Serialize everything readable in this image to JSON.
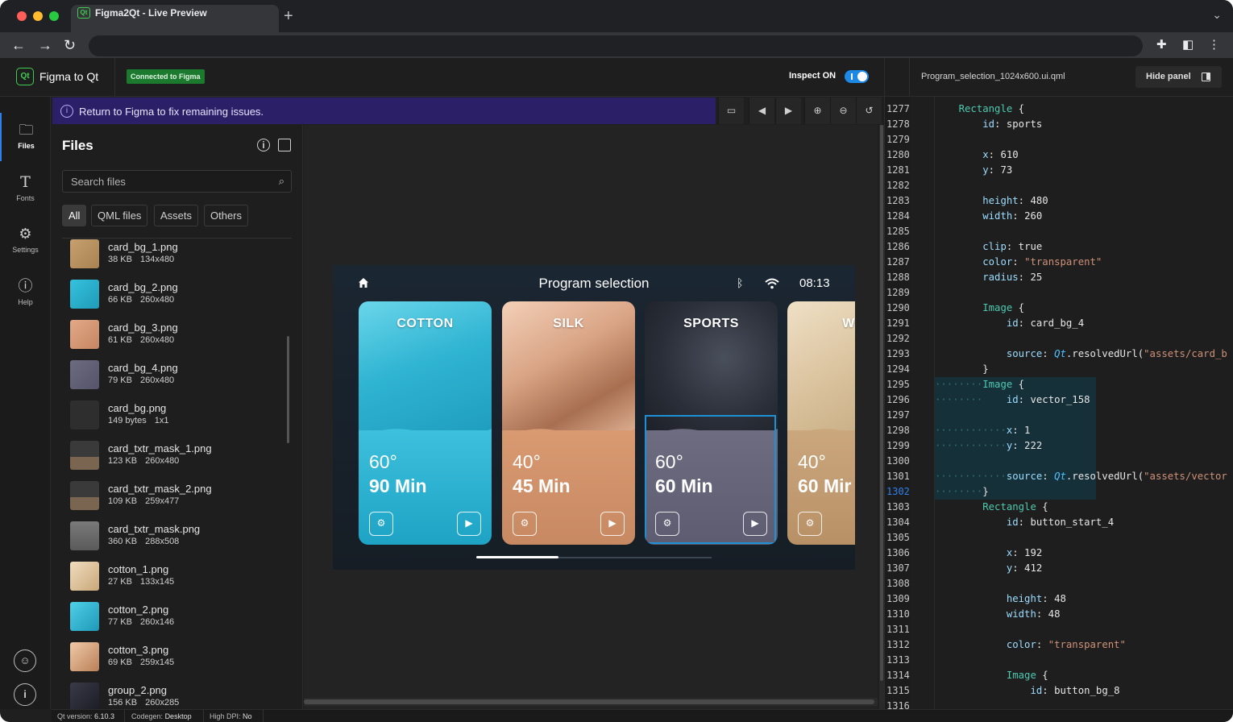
{
  "browser": {
    "tab_title": "Figma2Qt - Live Preview",
    "tab_favicon_text": "Qt",
    "traffic_colors": [
      "#ff5f57",
      "#febc2e",
      "#28c840"
    ]
  },
  "app": {
    "logo_text": "Qt",
    "title": "Figma to Qt",
    "connection_badge": "Connected to Figma",
    "inspect_label": "Inspect ON",
    "inspect_on": true,
    "accent_color": "#1e88e5"
  },
  "rail": {
    "items": [
      {
        "label": "Files",
        "icon": "folder-icon",
        "active": true
      },
      {
        "label": "Fonts",
        "icon": "text-icon",
        "active": false
      },
      {
        "label": "Settings",
        "icon": "gear-icon",
        "active": false
      },
      {
        "label": "Help",
        "icon": "help-icon",
        "active": false
      }
    ],
    "bottom_icons": [
      "user-icon",
      "info-icon"
    ]
  },
  "banner": {
    "text": "Return to Figma to fix remaining issues."
  },
  "preview_toolbar": [
    "monitor-icon",
    "prev-icon",
    "next-icon",
    "zoom-in-icon",
    "zoom-out-icon",
    "reset-icon"
  ],
  "files": {
    "title": "Files",
    "search_placeholder": "Search files",
    "filters": [
      {
        "label": "All",
        "active": true
      },
      {
        "label": "QML files",
        "active": false
      },
      {
        "label": "Assets",
        "active": false
      },
      {
        "label": "Others",
        "active": false
      }
    ],
    "items": [
      {
        "name": "card_bg_1.png",
        "size": "38 KB",
        "dims": "134x480",
        "thumb": "linear-gradient(135deg,#c8a070,#a88250)"
      },
      {
        "name": "card_bg_2.png",
        "size": "66 KB",
        "dims": "260x480",
        "thumb": "linear-gradient(135deg,#35c2dd,#1f9bb8)"
      },
      {
        "name": "card_bg_3.png",
        "size": "61 KB",
        "dims": "260x480",
        "thumb": "linear-gradient(135deg,#e3a988,#c58662)"
      },
      {
        "name": "card_bg_4.png",
        "size": "79 KB",
        "dims": "260x480",
        "thumb": "linear-gradient(135deg,#6c6b7f,#55546a)"
      },
      {
        "name": "card_bg.png",
        "size": "149 bytes",
        "dims": "1x1",
        "thumb": "#2e2e2e"
      },
      {
        "name": "card_txtr_mask_1.png",
        "size": "123 KB",
        "dims": "260x480",
        "thumb": "linear-gradient(180deg,#3a3a3a 55%,#7a6550 56%)"
      },
      {
        "name": "card_txtr_mask_2.png",
        "size": "109 KB",
        "dims": "259x477",
        "thumb": "linear-gradient(180deg,#3a3a3a 55%,#7a6550 56%)"
      },
      {
        "name": "card_txtr_mask.png",
        "size": "360 KB",
        "dims": "288x508",
        "thumb": "linear-gradient(180deg,#7a7a7a,#5a5a5a)"
      },
      {
        "name": "cotton_1.png",
        "size": "27 KB",
        "dims": "133x145",
        "thumb": "linear-gradient(135deg,#f0dcc0,#c9a878)"
      },
      {
        "name": "cotton_2.png",
        "size": "77 KB",
        "dims": "260x146",
        "thumb": "linear-gradient(135deg,#4fd0e8,#1f98b8)"
      },
      {
        "name": "cotton_3.png",
        "size": "69 KB",
        "dims": "259x145",
        "thumb": "linear-gradient(135deg,#f1c9a8,#b88058)"
      },
      {
        "name": "group_2.png",
        "size": "156 KB",
        "dims": "260x285",
        "thumb": "linear-gradient(135deg,#3a3a48,#1c1c26)"
      }
    ]
  },
  "device": {
    "title": "Program selection",
    "time": "08:13",
    "cards": [
      {
        "name": "COTTON",
        "temp": "60°",
        "time": "90 Min",
        "photo": "linear-gradient(160deg,#6ad6ea 0%,#2fb4d2 45%,#1e9bbd 100%)",
        "body": "linear-gradient(180deg,#3cc0dc,#1fa3c5)"
      },
      {
        "name": "SILK",
        "temp": "40°",
        "time": "45 Min",
        "photo": "linear-gradient(150deg,#f3d0b8 0%,#d9a485 40%,#a86f51 70%,#e7b99c 100%)",
        "body": "linear-gradient(180deg,#d99a72,#c78962)"
      },
      {
        "name": "SPORTS",
        "temp": "60°",
        "time": "60 Min",
        "photo": "radial-gradient(circle at 60% 40%,#4a4f5c 0%,#2a2e38 55%,#1a1d24 100%)",
        "body": "linear-gradient(180deg,#6e6c80,#5e5c70)"
      },
      {
        "name": "WO",
        "temp": "40°",
        "time": "60 Mir",
        "photo": "linear-gradient(150deg,#efe0c6 0%,#d8c09a 50%,#bfa57c 100%)",
        "body": "linear-gradient(180deg,#cba77d,#b89066)"
      }
    ],
    "selected_card": 2,
    "page_progress": 0.35
  },
  "code": {
    "file": "Program_selection_1024x600.ui.qml",
    "hide_label": "Hide panel",
    "current_line": "1302",
    "lines": [
      {
        "n": "1277",
        "indent": "    ",
        "parts": [
          [
            "t",
            "Rectangle"
          ],
          [
            "v",
            " {"
          ]
        ]
      },
      {
        "n": "1278",
        "indent": "        ",
        "parts": [
          [
            "p",
            "id"
          ],
          [
            "v",
            ": sports"
          ]
        ]
      },
      {
        "n": "1279",
        "indent": "",
        "parts": []
      },
      {
        "n": "1280",
        "indent": "        ",
        "parts": [
          [
            "p",
            "x"
          ],
          [
            "v",
            ": 610"
          ]
        ]
      },
      {
        "n": "1281",
        "indent": "        ",
        "parts": [
          [
            "p",
            "y"
          ],
          [
            "v",
            ": 73"
          ]
        ]
      },
      {
        "n": "1282",
        "indent": "",
        "parts": []
      },
      {
        "n": "1283",
        "indent": "        ",
        "parts": [
          [
            "p",
            "height"
          ],
          [
            "v",
            ": 480"
          ]
        ]
      },
      {
        "n": "1284",
        "indent": "        ",
        "parts": [
          [
            "p",
            "width"
          ],
          [
            "v",
            ": 260"
          ]
        ]
      },
      {
        "n": "1285",
        "indent": "",
        "parts": []
      },
      {
        "n": "1286",
        "indent": "        ",
        "parts": [
          [
            "p",
            "clip"
          ],
          [
            "v",
            ": true"
          ]
        ]
      },
      {
        "n": "1287",
        "indent": "        ",
        "parts": [
          [
            "p",
            "color"
          ],
          [
            "v",
            ": "
          ],
          [
            "s",
            "\"transparent\""
          ]
        ]
      },
      {
        "n": "1288",
        "indent": "        ",
        "parts": [
          [
            "p",
            "radius"
          ],
          [
            "v",
            ": 25"
          ]
        ]
      },
      {
        "n": "1289",
        "indent": "",
        "parts": []
      },
      {
        "n": "1290",
        "indent": "        ",
        "parts": [
          [
            "t",
            "Image"
          ],
          [
            "v",
            " {"
          ]
        ]
      },
      {
        "n": "1291",
        "indent": "            ",
        "parts": [
          [
            "p",
            "id"
          ],
          [
            "v",
            ": card_bg_4"
          ]
        ]
      },
      {
        "n": "1292",
        "indent": "",
        "parts": []
      },
      {
        "n": "1293",
        "indent": "            ",
        "parts": [
          [
            "p",
            "source"
          ],
          [
            "v",
            ": "
          ],
          [
            "q",
            "Qt"
          ],
          [
            "v",
            ".resolvedUrl("
          ],
          [
            "s",
            "\"assets/card_b"
          ]
        ]
      },
      {
        "n": "1294",
        "indent": "        ",
        "parts": [
          [
            "v",
            "}"
          ]
        ]
      },
      {
        "n": "1295",
        "indent": "",
        "hl": true,
        "parts": [
          [
            "d",
            "········"
          ],
          [
            "t",
            "Image"
          ],
          [
            "v",
            " {"
          ]
        ]
      },
      {
        "n": "1296",
        "indent": "",
        "hl": true,
        "parts": [
          [
            "d",
            "········"
          ],
          [
            "v",
            "    "
          ],
          [
            "p",
            "id"
          ],
          [
            "v",
            ": vector_158"
          ]
        ]
      },
      {
        "n": "1297",
        "indent": "",
        "hl": true,
        "parts": []
      },
      {
        "n": "1298",
        "indent": "",
        "hl": true,
        "parts": [
          [
            "d",
            "············"
          ],
          [
            "p",
            "x"
          ],
          [
            "v",
            ": 1"
          ]
        ]
      },
      {
        "n": "1299",
        "indent": "",
        "hl": true,
        "parts": [
          [
            "d",
            "············"
          ],
          [
            "p",
            "y"
          ],
          [
            "v",
            ": 222"
          ]
        ]
      },
      {
        "n": "1300",
        "indent": "",
        "hl": true,
        "parts": []
      },
      {
        "n": "1301",
        "indent": "",
        "hl": true,
        "parts": [
          [
            "d",
            "············"
          ],
          [
            "p",
            "source"
          ],
          [
            "v",
            ": "
          ],
          [
            "q",
            "Qt"
          ],
          [
            "v",
            ".resolvedUrl("
          ],
          [
            "s",
            "\"assets/vector"
          ]
        ]
      },
      {
        "n": "1302",
        "indent": "",
        "hl": true,
        "parts": [
          [
            "d",
            "········"
          ],
          [
            "v",
            "}"
          ]
        ]
      },
      {
        "n": "1303",
        "indent": "        ",
        "parts": [
          [
            "t",
            "Rectangle"
          ],
          [
            "v",
            " {"
          ]
        ]
      },
      {
        "n": "1304",
        "indent": "            ",
        "parts": [
          [
            "p",
            "id"
          ],
          [
            "v",
            ": button_start_4"
          ]
        ]
      },
      {
        "n": "1305",
        "indent": "",
        "parts": []
      },
      {
        "n": "1306",
        "indent": "            ",
        "parts": [
          [
            "p",
            "x"
          ],
          [
            "v",
            ": 192"
          ]
        ]
      },
      {
        "n": "1307",
        "indent": "            ",
        "parts": [
          [
            "p",
            "y"
          ],
          [
            "v",
            ": 412"
          ]
        ]
      },
      {
        "n": "1308",
        "indent": "",
        "parts": []
      },
      {
        "n": "1309",
        "indent": "            ",
        "parts": [
          [
            "p",
            "height"
          ],
          [
            "v",
            ": 48"
          ]
        ]
      },
      {
        "n": "1310",
        "indent": "            ",
        "parts": [
          [
            "p",
            "width"
          ],
          [
            "v",
            ": 48"
          ]
        ]
      },
      {
        "n": "1311",
        "indent": "",
        "parts": []
      },
      {
        "n": "1312",
        "indent": "            ",
        "parts": [
          [
            "p",
            "color"
          ],
          [
            "v",
            ": "
          ],
          [
            "s",
            "\"transparent\""
          ]
        ]
      },
      {
        "n": "1313",
        "indent": "",
        "parts": []
      },
      {
        "n": "1314",
        "indent": "            ",
        "parts": [
          [
            "t",
            "Image"
          ],
          [
            "v",
            " {"
          ]
        ]
      },
      {
        "n": "1315",
        "indent": "                ",
        "parts": [
          [
            "p",
            "id"
          ],
          [
            "v",
            ": button_bg_8"
          ]
        ]
      },
      {
        "n": "1316",
        "indent": "",
        "parts": []
      }
    ]
  },
  "status": {
    "qt_label": "Qt version:",
    "qt_value": "6.10.3",
    "codegen_label": "Codegen:",
    "codegen_value": "Desktop",
    "dpi_label": "High DPI:",
    "dpi_value": "No"
  }
}
